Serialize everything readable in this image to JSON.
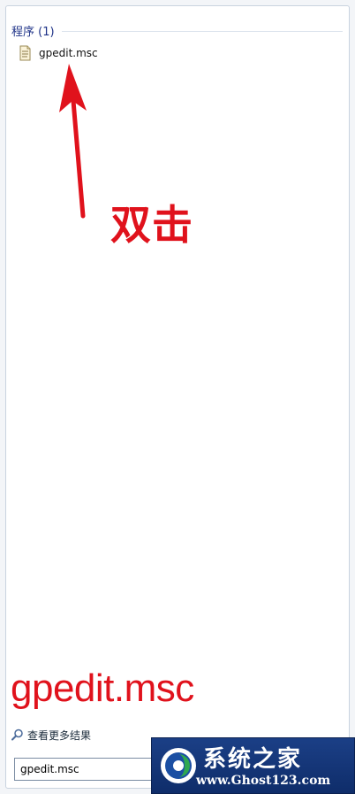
{
  "results": {
    "group_title": "程序 (1)",
    "items": [
      {
        "label": "gpedit.msc",
        "icon": "msc-document-icon"
      }
    ]
  },
  "annotation": {
    "instruction": "双击",
    "caption": "gpedit.msc",
    "color": "#e0121c"
  },
  "footer": {
    "see_more_label": "查看更多结果",
    "search_value": "gpedit.msc"
  },
  "watermark": {
    "name": "系统之家",
    "url": "www.Ghost123.com"
  }
}
